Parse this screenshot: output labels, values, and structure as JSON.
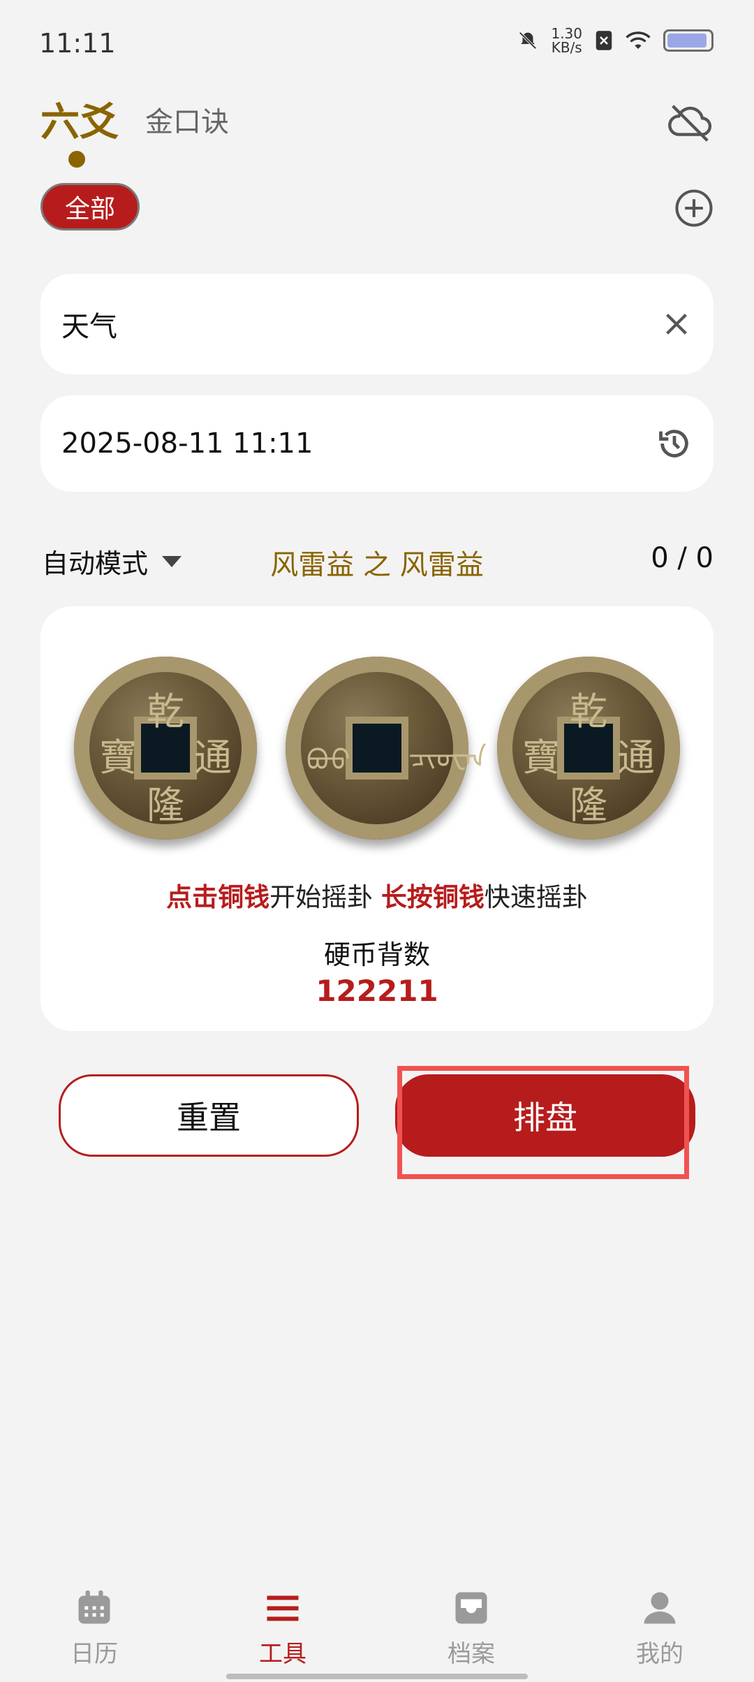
{
  "status": {
    "time": "11:11",
    "speed_value": "1.30",
    "speed_unit": "KB/s"
  },
  "header": {
    "tab_active": "六爻",
    "tab_inactive": "金口诀"
  },
  "filter": {
    "chip_label": "全部"
  },
  "question": {
    "value": "天气"
  },
  "datetime": {
    "value": "2025-08-11 11:11"
  },
  "mode": {
    "label": "自动模式",
    "gua_name": "风雷益 之 风雷益",
    "count": "0 / 0"
  },
  "coins": {
    "items": [
      {
        "top": "乾",
        "bottom": "隆",
        "left": "寶",
        "right": "通"
      },
      {
        "top": "",
        "bottom": "",
        "left": "ᠪᠣᠣ",
        "right": "ᠴᡳᠣᠸᠠᠨ"
      },
      {
        "top": "乾",
        "bottom": "隆",
        "left": "寶",
        "right": "通"
      }
    ],
    "hint_tap": "点击铜钱",
    "hint_tap_rest": "开始摇卦 ",
    "hint_long": "长按铜钱",
    "hint_long_rest": "快速摇卦",
    "back_label": "硬币背数",
    "back_value": "122211"
  },
  "actions": {
    "reset": "重置",
    "chart": "排盘"
  },
  "nav": {
    "items": [
      {
        "label": "日历",
        "icon": "calendar-icon",
        "active": false
      },
      {
        "label": "工具",
        "icon": "menu-icon",
        "active": true
      },
      {
        "label": "档案",
        "icon": "archive-icon",
        "active": false
      },
      {
        "label": "我的",
        "icon": "person-icon",
        "active": false
      }
    ]
  },
  "colors": {
    "accent": "#b71c1c",
    "gold": "#8a6400"
  }
}
